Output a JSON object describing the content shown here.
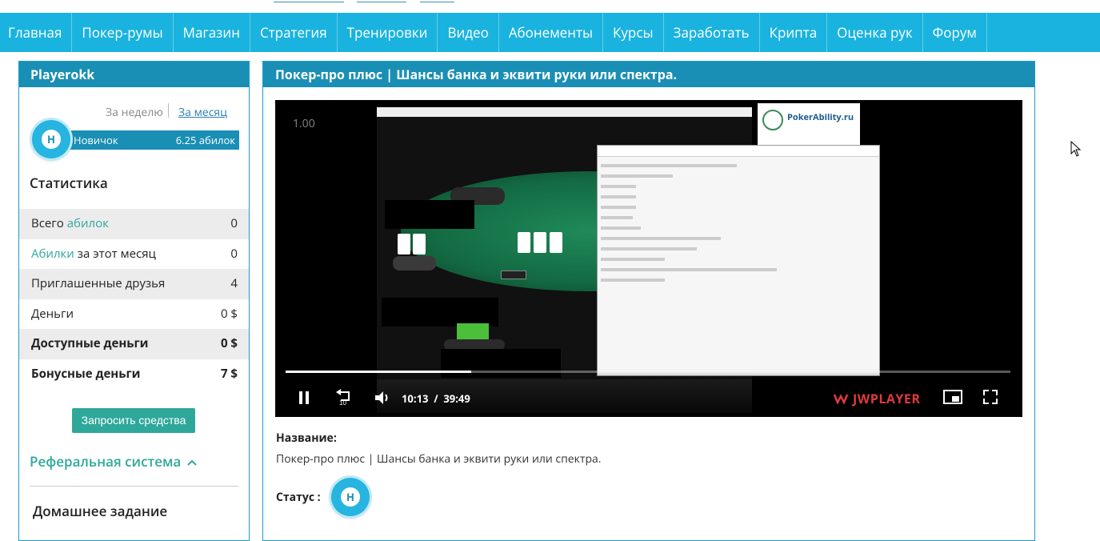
{
  "nav": {
    "items": [
      "Главная",
      "Покер-румы",
      "Магазин",
      "Стратегия",
      "Тренировки",
      "Видео",
      "Абонементы",
      "Курсы",
      "Заработать",
      "Крипта",
      "Оценка рук",
      "Форум"
    ]
  },
  "sidebar": {
    "title": "Playerokk",
    "period_week": "За неделю",
    "period_month": "За месяц",
    "rank_name": "Новичок",
    "rank_points": "6.25 абилок",
    "badge_letter": "Н",
    "stats_title": "Статистика",
    "stats": [
      {
        "pre": "Всего ",
        "link": "абилок",
        "post": "",
        "value": "0",
        "bold": false
      },
      {
        "pre": "",
        "link": "Абилки",
        "post": " за этот месяц",
        "value": "0",
        "bold": false
      },
      {
        "pre": "Приглашенные друзья",
        "link": "",
        "post": "",
        "value": "4",
        "bold": false
      },
      {
        "pre": "Деньги",
        "link": "",
        "post": "",
        "value": "0 $",
        "bold": false
      },
      {
        "pre": "Доступные деньги",
        "link": "",
        "post": "",
        "value": "0 $",
        "bold": true
      },
      {
        "pre": "Бонусные деньги",
        "link": "",
        "post": "",
        "value": "7 $",
        "bold": true
      }
    ],
    "request_button": "Запросить средства",
    "referral": "Реферальная система",
    "homework": "Домашнее задание"
  },
  "main": {
    "title": "Покер-про плюс | Шансы банка и эквити руки или спектра.",
    "player": {
      "speed": "1.00",
      "current_time": "10:13",
      "duration": "39:49",
      "progress": 0.256,
      "brand": "JWPLAYER",
      "logo_text": "PokerAbility.ru"
    },
    "name_label": "Название:",
    "name_value": "Покер-про плюс | Шансы банка и эквити руки или спектра.",
    "status_label": "Статус :",
    "status_badge": "Н"
  }
}
